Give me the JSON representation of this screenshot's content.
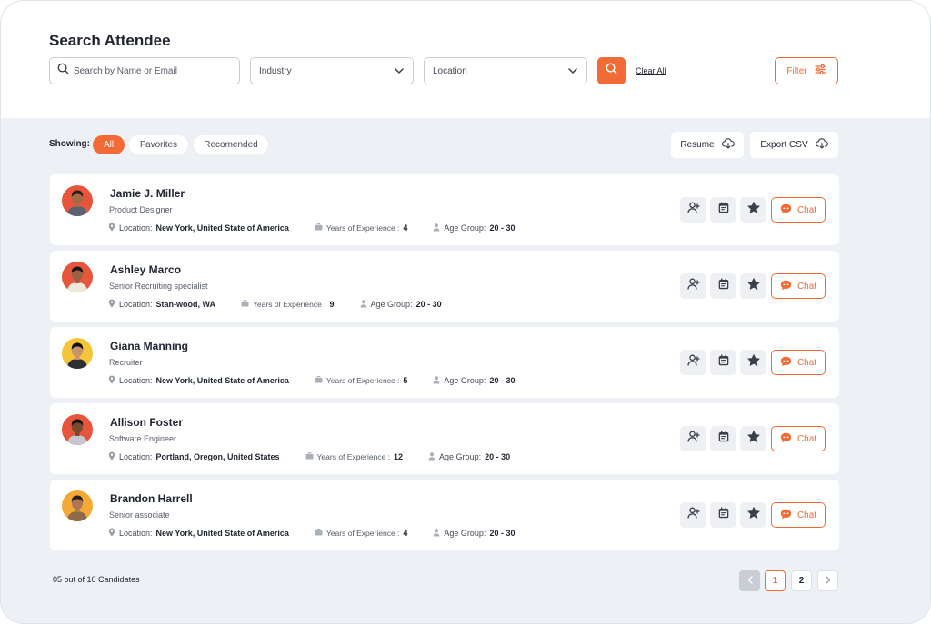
{
  "header": {
    "title": "Search Attendee",
    "search_placeholder": "Search by Name or Email",
    "industry_label": "Industry",
    "location_label": "Location",
    "clear_all": "Clear All",
    "filter_label": "Filter"
  },
  "toolbar": {
    "showing_label": "Showing:",
    "tabs": [
      "All",
      "Favorites",
      "Recomended"
    ],
    "active_tab": "All",
    "resume_label": "Resume",
    "export_label": "Export CSV"
  },
  "labels": {
    "location": "Location:",
    "experience": "Years of Experience :",
    "age_group": "Age Group:",
    "chat": "Chat"
  },
  "candidates": [
    {
      "name": "Jamie J. Miller",
      "role": "Product Designer",
      "location": "New York, United State of America",
      "experience": "4",
      "age_group": "20 - 30",
      "avatar_bg": "#e8553d",
      "skin": "#a66a45",
      "hair": "#2b1d14",
      "shirt": "#5a6170"
    },
    {
      "name": "Ashley Marco",
      "role": "Senior Recruiting specialist",
      "location": "Stan-wood, WA",
      "experience": "9",
      "age_group": "20 - 30",
      "avatar_bg": "#e8553d",
      "skin": "#9a6242",
      "hair": "#1c1410",
      "shirt": "#f0e8dd"
    },
    {
      "name": "Giana Manning",
      "role": "Recruiter",
      "location": "New York, United State of America",
      "experience": "5",
      "age_group": "20 - 30",
      "avatar_bg": "#f3c53a",
      "skin": "#c9936d",
      "hair": "#15110e",
      "shirt": "#2d2d33"
    },
    {
      "name": "Allison Foster",
      "role": "Software Engineer",
      "location": "Portland, Oregon, United States",
      "experience": "12",
      "age_group": "20 - 30",
      "avatar_bg": "#e8553d",
      "skin": "#7a4a30",
      "hair": "#1a120d",
      "shirt": "#c5c8cf"
    },
    {
      "name": "Brandon Harrell",
      "role": "Senior associate",
      "location": "New York, United State of America",
      "experience": "4",
      "age_group": "20 - 30",
      "avatar_bg": "#f3a935",
      "skin": "#b07552",
      "hair": "#2a1d15",
      "shirt": "#8e6b4c"
    }
  ],
  "footer": {
    "count_text": "05 out of 10 Candidates",
    "pages": [
      "1",
      "2"
    ],
    "current_page": "1"
  },
  "colors": {
    "accent": "#f26a35",
    "background": "#edf0f4",
    "text": "#1f2430"
  },
  "icons": [
    "search-icon",
    "chevron-down-icon",
    "filter-sliders-icon",
    "cloud-download-icon",
    "location-pin-icon",
    "briefcase-icon",
    "person-icon",
    "add-user-icon",
    "calendar-icon",
    "star-icon",
    "chat-bubble-icon",
    "chevron-left-icon",
    "chevron-right-icon"
  ]
}
